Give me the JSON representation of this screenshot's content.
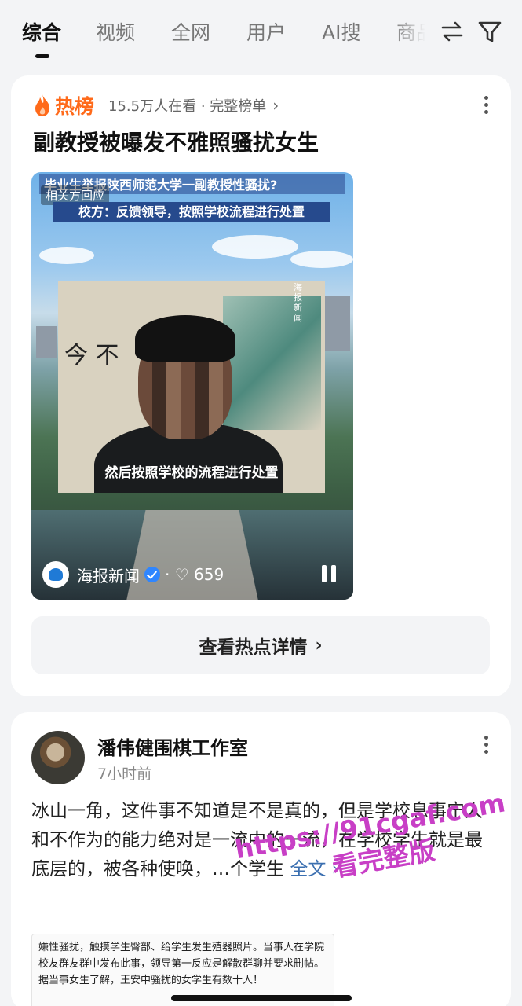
{
  "tabs": {
    "items": [
      "综合",
      "视频",
      "全网",
      "用户",
      "AI搜",
      "商品"
    ],
    "active": "综合"
  },
  "hot_card": {
    "label": "热榜",
    "meta": "15.5万人在看 · 完整榜单",
    "arrow": "›",
    "headline": "副教授被曝发不雅照骚扰女生",
    "video": {
      "top_text": "毕业生举报陕西师范大学一副教授性骚扰?",
      "badge": "相关方回应",
      "banner": "校方：反馈领导，按照学校流程进行处置",
      "subtitle": "然后按照学校的流程进行处置",
      "inset_watermark": "海报新闻",
      "calligraphy": "今 不",
      "source": "海报新闻",
      "likes": "· ♡ 659"
    },
    "detail_button": "查看热点详情",
    "detail_arrow": "›"
  },
  "post_card": {
    "author": "潘伟健围棋工作室",
    "time": "7小时前",
    "body": "冰山一角，这件事不知道是不是真的，但是学校息事宁人和不作为的能力绝对是一流中的一流，在学校学生就是最底层的，被各种使唤，…个学生",
    "more": "全文 ›",
    "quote": "嫌性骚扰，触摸学生臀部、给学生发生殖器照片。当事人在学院校友群友群中发布此事，领导第一反应是解散群聊并要求删帖。据当事女生了解，王安中骚扰的女学生有数十人！"
  },
  "overlay_watermark": {
    "line1": "https://91cgaf.com",
    "line2": "看完整版"
  },
  "colors": {
    "hot_orange": "#ff6a1a",
    "verified_blue": "#2f86ff",
    "watermark_magenta": "#c83fc6"
  }
}
